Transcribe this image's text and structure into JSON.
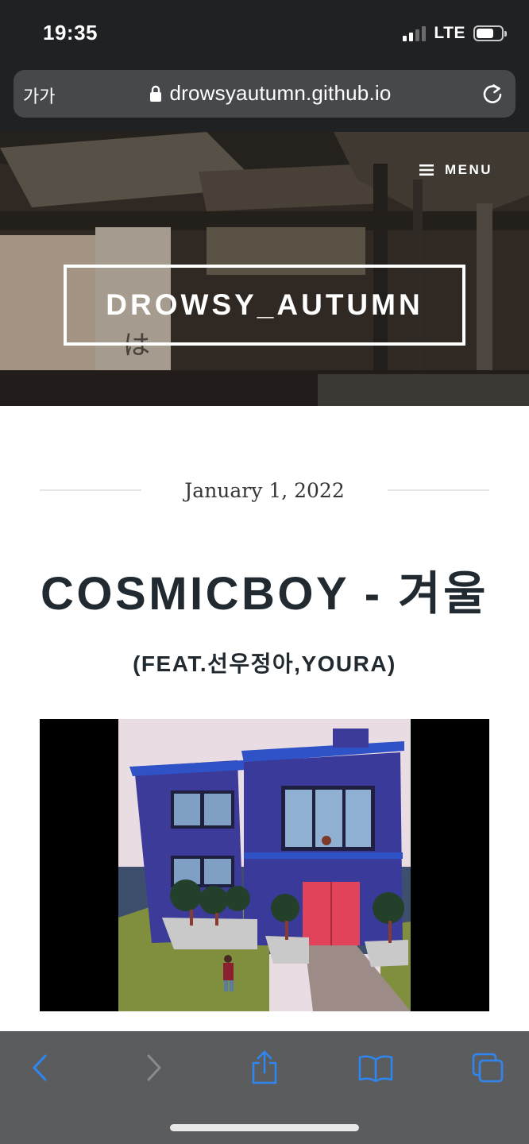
{
  "status_bar": {
    "time": "19:35",
    "network": "LTE",
    "signal_bars_active": 2,
    "signal_bars_total": 4,
    "battery_level": 0.7
  },
  "address_bar": {
    "text_size_label": "가가",
    "url": "drowsyautumn.github.io",
    "lock_icon": "lock-icon",
    "reload_icon": "reload-icon"
  },
  "site": {
    "menu_label": "MENU",
    "menu_icon": "hamburger-icon",
    "title": "DROWSY_AUTUMN"
  },
  "post": {
    "date": "January 1, 2022",
    "title": "COSMICBOY - 겨울",
    "subtitle": "(FEAT.선우정아,YOURA)"
  },
  "toolbar": {
    "back_icon": "back-chevron-icon",
    "forward_icon": "forward-chevron-icon",
    "share_icon": "share-icon",
    "bookmarks_icon": "book-icon",
    "tabs_icon": "tabs-icon",
    "accent_color": "#2f86f0",
    "disabled_color": "#8a8b8d"
  },
  "colors": {
    "chrome_background": "#1f2123",
    "address_bar_background": "#46484b",
    "toolbar_background": "#5b5c5e",
    "title_text": "#222a31"
  }
}
